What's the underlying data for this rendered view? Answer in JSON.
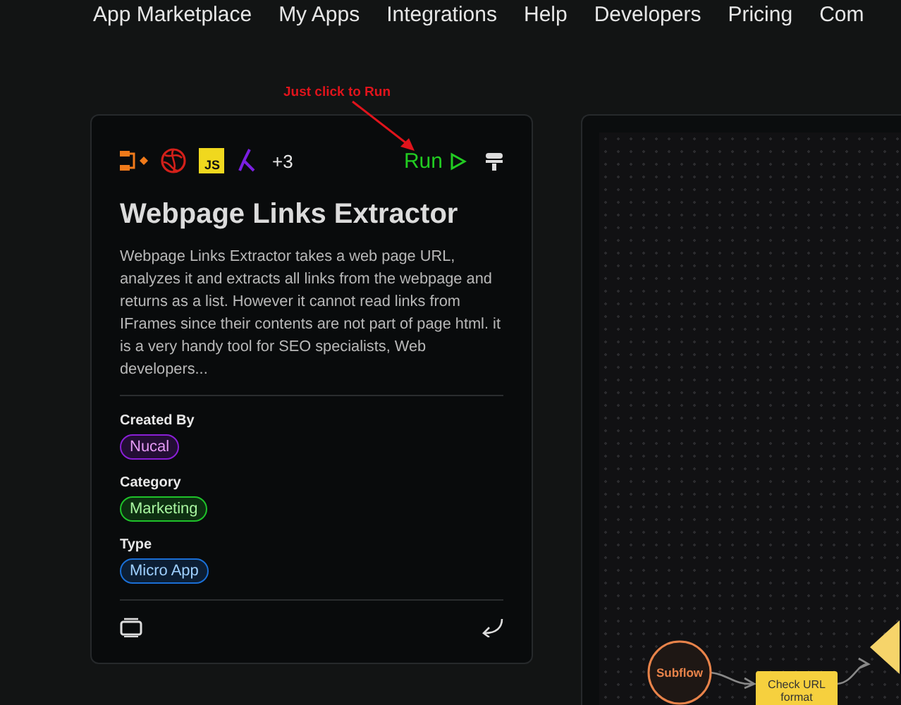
{
  "nav": {
    "items": [
      {
        "label": "App Marketplace"
      },
      {
        "label": "My Apps"
      },
      {
        "label": "Integrations"
      },
      {
        "label": "Help"
      },
      {
        "label": "Developers"
      },
      {
        "label": "Pricing"
      },
      {
        "label": "Com"
      }
    ]
  },
  "annotation": {
    "text": "Just click to Run"
  },
  "app_card": {
    "badge_text": "JS",
    "extra_count": "+3",
    "run_label": "Run",
    "title": "Webpage Links Extractor",
    "description": "Webpage Links Extractor takes a web page URL, analyzes it and extracts all links from the webpage and returns as a list. However it cannot read links from IFrames since their contents are not part of page html. it is a very handy tool for SEO specialists, Web developers...",
    "sections": [
      {
        "label": "Created By",
        "tag": "Nucal",
        "color": "#8a1fd6"
      },
      {
        "label": "Category",
        "tag": "Marketing",
        "color": "#1fc22a"
      },
      {
        "label": "Type",
        "tag": "Micro App",
        "color": "#1a6fd6"
      }
    ]
  },
  "canvas": {
    "nodes": [
      {
        "kind": "circle",
        "label": "Subflow"
      },
      {
        "kind": "rect",
        "label": "Check URL format"
      },
      {
        "kind": "diamond"
      }
    ]
  }
}
